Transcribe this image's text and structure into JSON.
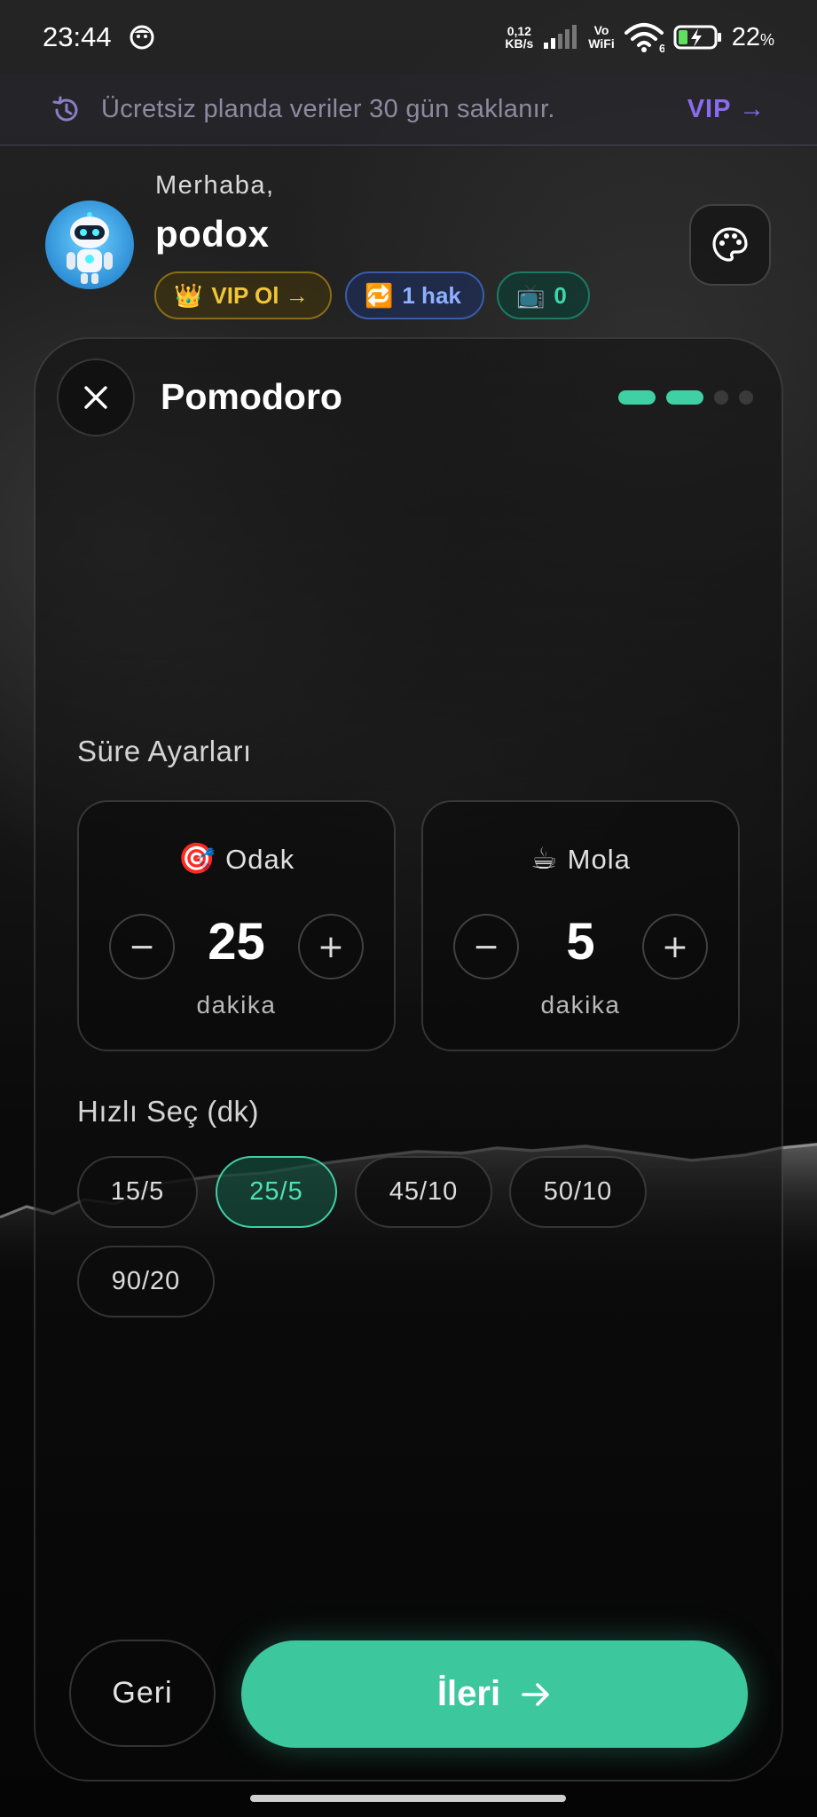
{
  "status_bar": {
    "time": "23:44",
    "net_speed_value": "0,12",
    "net_speed_unit": "KB/s",
    "vo": "Vo",
    "wifi_label": "WiFi",
    "wifi_level": "6",
    "battery": "22",
    "battery_unit": "%"
  },
  "banner": {
    "text": "Ücretsiz planda veriler 30 gün saklanır.",
    "vip_link": "VIP →"
  },
  "header": {
    "greeting": "Merhaba,",
    "username": "podox",
    "chips": {
      "vip": {
        "emoji": "👑",
        "label": "VIP Ol →"
      },
      "hak": {
        "emoji": "🔁",
        "label": "1 hak"
      },
      "tv": {
        "emoji": "📺",
        "label": "0"
      }
    }
  },
  "wizard": {
    "title": "Pomodoro",
    "steps_total": 4,
    "steps_completed": 2,
    "durations_title": "Süre Ayarları",
    "focus": {
      "emoji": "🎯",
      "label": "Odak",
      "value": "25",
      "unit": "dakika",
      "minus": "−",
      "plus": "+"
    },
    "break": {
      "emoji": "☕",
      "label": "Mola",
      "value": "5",
      "unit": "dakika",
      "minus": "−",
      "plus": "+"
    },
    "quick_title": "Hızlı Seç (dk)",
    "presets": [
      "15/5",
      "25/5",
      "45/10",
      "50/10",
      "90/20"
    ],
    "selected_preset": "25/5",
    "back_label": "Geri",
    "next_label": "İleri"
  },
  "colors": {
    "accent": "#3cc79d",
    "vip_purple": "#8b6cf0",
    "gold": "#f0c53a"
  }
}
